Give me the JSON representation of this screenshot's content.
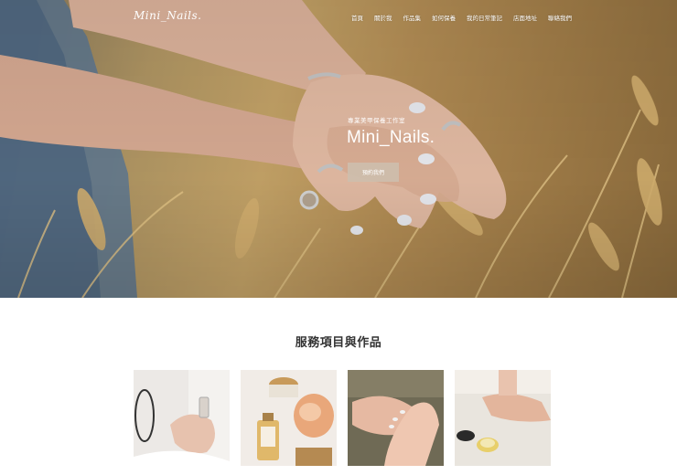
{
  "brand": {
    "logo": "Mini_Nails."
  },
  "nav": {
    "items": [
      "首頁",
      "關於我",
      "作品集",
      "如何保養",
      "我的日常筆記",
      "店面地址",
      "聯絡我們"
    ]
  },
  "hero": {
    "subtitle": "專業美甲保養工作室",
    "title": "Mini_Nails.",
    "button_label": "預約我們"
  },
  "services": {
    "heading": "服務項目與作品",
    "tiles": [
      {
        "icon": "photo-perfume-hands"
      },
      {
        "icon": "photo-cosmetics-products"
      },
      {
        "icon": "photo-manicure-hands"
      },
      {
        "icon": "photo-hand-cream"
      }
    ]
  },
  "colors": {
    "accent": "#cdbeac",
    "wheat": "#c9a76a",
    "text": "#333333"
  }
}
